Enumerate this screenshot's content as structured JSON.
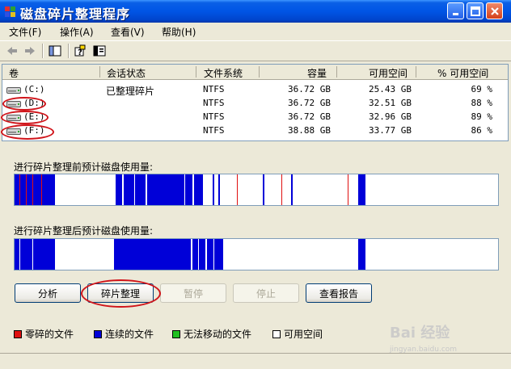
{
  "window": {
    "title": "磁盘碎片整理程序"
  },
  "menu": [
    "文件(F)",
    "操作(A)",
    "查看(V)",
    "帮助(H)"
  ],
  "table": {
    "headers": [
      "卷",
      "会话状态",
      "文件系统",
      "容量",
      "可用空间",
      "% 可用空间"
    ],
    "rows": [
      [
        "(C:)",
        "已整理碎片",
        "NTFS",
        "36.72 GB",
        "25.43 GB",
        "69 %"
      ],
      [
        "(D:)",
        "",
        "NTFS",
        "36.72 GB",
        "32.51 GB",
        "88 %"
      ],
      [
        "(E:)",
        "",
        "NTFS",
        "36.72 GB",
        "32.96 GB",
        "89 %"
      ],
      [
        "(F:)",
        "",
        "NTFS",
        "38.88 GB",
        "33.77 GB",
        "86 %"
      ]
    ]
  },
  "analysis": {
    "before_label": "进行碎片整理前预计磁盘使用量:",
    "after_label": "进行碎片整理后预计磁盘使用量:"
  },
  "buttons": {
    "analyze": "分析",
    "defrag": "碎片整理",
    "pause": "暂停",
    "stop": "停止",
    "report": "查看报告"
  },
  "legend": [
    {
      "label": "零碎的文件",
      "color": "#e01010"
    },
    {
      "label": "连续的文件",
      "color": "#0000d8"
    },
    {
      "label": "无法移动的文件",
      "color": "#20c020"
    },
    {
      "label": "可用空间",
      "color": "#ffffff"
    }
  ],
  "colors": {
    "fragmented": "#e01010",
    "contiguous": "#0000d8",
    "unmovable": "#20c020",
    "free": "#ffffff",
    "annotation": "#d0141a"
  },
  "watermark": {
    "text": "Bai 经验",
    "sub": "jingyan.baidu.com"
  }
}
